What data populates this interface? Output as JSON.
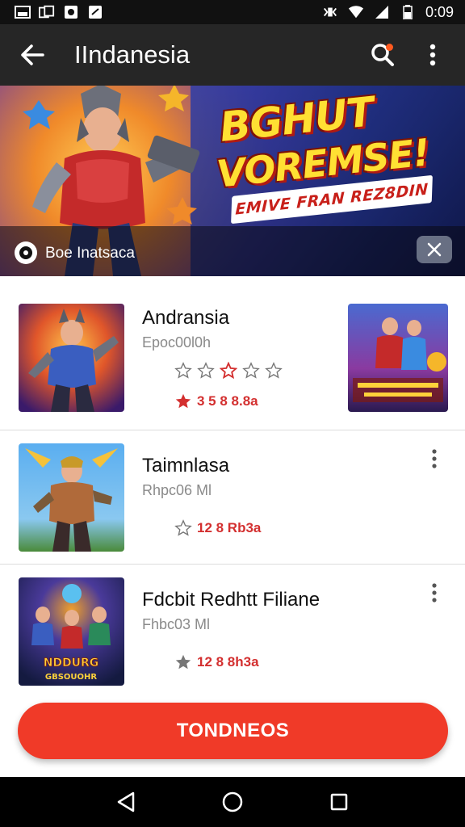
{
  "status_bar": {
    "time": "0:09",
    "left_icons": [
      "image-icon",
      "cards-icon",
      "shield-icon",
      "camera-icon"
    ],
    "right_icons": [
      "vibrate-icon",
      "wifi-icon",
      "signal-icon",
      "battery-icon"
    ]
  },
  "app_bar": {
    "title": "IIndanesia",
    "back_icon": "arrow-left-icon",
    "search_icon": "search-icon",
    "menu_icon": "more-vert-icon",
    "notification_color": "#ff5a1f"
  },
  "banner": {
    "headline_line1": "BGHUT",
    "headline_line2": "VOREMSE!",
    "subtitle": "EMIVE FRAN REZ8DIN",
    "caption": "Boe Inatsaca",
    "close_icon": "close-icon"
  },
  "list": {
    "items": [
      {
        "title": "Andransia",
        "subtitle": "Epoc00l0h",
        "rating_text": "3 5 8 8.8a",
        "stars": [
          "star-outline",
          "star-outline",
          "star-filled-red",
          "star-outline",
          "star-outline"
        ]
      },
      {
        "title": "Taimnlasa",
        "subtitle": "Rhpc06 Ml",
        "rating_text": "12 8 Rb3a"
      },
      {
        "title": "Fdcbit Redhtt Filiane",
        "subtitle": "Fhbc03 Ml",
        "rating_text": "12 8 8h3a"
      }
    ],
    "thumb3_text": "NDDURG GBSOUOHR"
  },
  "cta": {
    "label": "TONDNEOS",
    "color": "#f03a28"
  },
  "nav_bar": {
    "icons": [
      "back-triangle-icon",
      "home-circle-icon",
      "recents-square-icon"
    ]
  }
}
